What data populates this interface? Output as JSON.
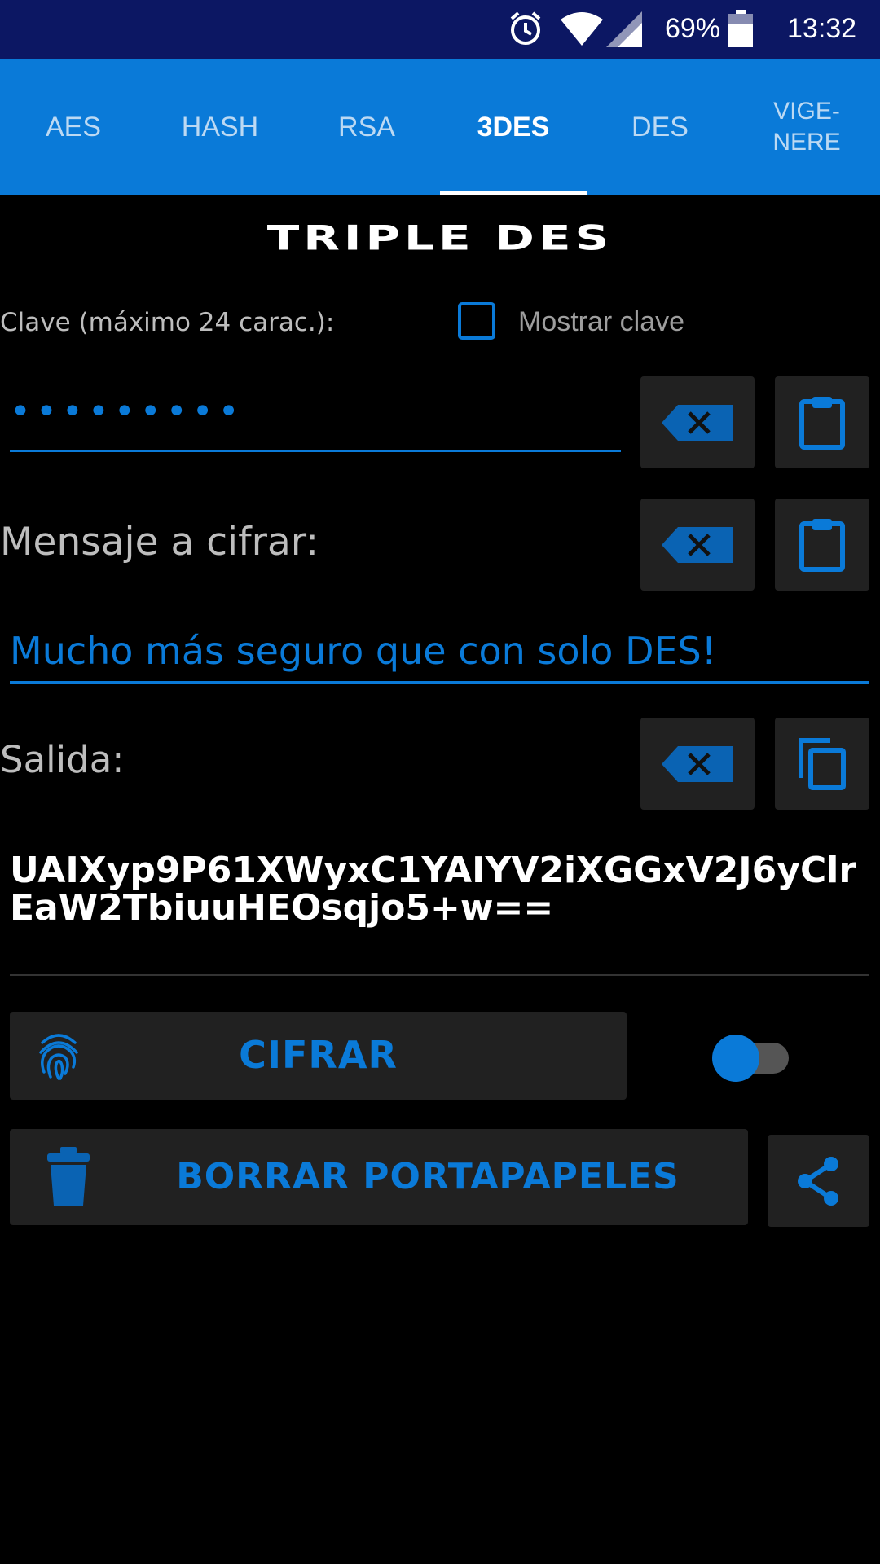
{
  "status_bar": {
    "battery": "69%",
    "time": "13:32"
  },
  "tabs": [
    {
      "label": "AES"
    },
    {
      "label": "HASH"
    },
    {
      "label": "RSA"
    },
    {
      "label": "3DES"
    },
    {
      "label": "DES"
    },
    {
      "label": "VIGE-\nNERE"
    }
  ],
  "active_tab": "3DES",
  "title": "TRIPLE DES",
  "key": {
    "label": "Clave (máximo 24 carac.):",
    "show_key_label": "Mostrar clave",
    "show_key_checked": false,
    "masked_value": "•••••••••"
  },
  "message": {
    "label": "Mensaje a cifrar:",
    "value": "Mucho más seguro que con solo DES!"
  },
  "output": {
    "label": "Salida:",
    "value": "UAIXyp9P61XWyxC1YAIYV2iXGGxV2J6yClrEaW2TbiuuHEOsqjo5+w=="
  },
  "actions": {
    "encrypt_label": "CIFRAR",
    "toggle_on": true,
    "clear_clipboard_label": "BORRAR PORTAPAPELES"
  },
  "colors": {
    "accent": "#0a7ad8",
    "status_bar": "#0c1763",
    "button_bg": "#212121",
    "background": "#000000"
  }
}
